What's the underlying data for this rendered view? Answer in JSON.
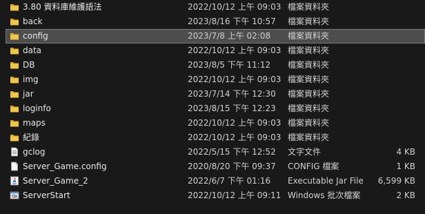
{
  "files": [
    {
      "name": "3.80 資料庫維護語法",
      "date": "2022/10/12 上午 09:03",
      "type": "檔案資料夾",
      "size": "",
      "icon": "folder-icon",
      "selected": false
    },
    {
      "name": "back",
      "date": "2023/8/16 下午 10:57",
      "type": "檔案資料夾",
      "size": "",
      "icon": "folder-icon",
      "selected": false
    },
    {
      "name": "config",
      "date": "2023/7/8 上午 02:08",
      "type": "檔案資料夾",
      "size": "",
      "icon": "folder-icon",
      "selected": true
    },
    {
      "name": "data",
      "date": "2022/10/12 上午 09:03",
      "type": "檔案資料夾",
      "size": "",
      "icon": "folder-icon",
      "selected": false
    },
    {
      "name": "DB",
      "date": "2023/8/5 下午 11:12",
      "type": "檔案資料夾",
      "size": "",
      "icon": "folder-icon",
      "selected": false
    },
    {
      "name": "img",
      "date": "2022/10/12 上午 09:03",
      "type": "檔案資料夾",
      "size": "",
      "icon": "folder-icon",
      "selected": false
    },
    {
      "name": "jar",
      "date": "2023/7/14 下午 12:30",
      "type": "檔案資料夾",
      "size": "",
      "icon": "folder-icon",
      "selected": false
    },
    {
      "name": "loginfo",
      "date": "2023/8/15 下午 12:23",
      "type": "檔案資料夾",
      "size": "",
      "icon": "folder-icon",
      "selected": false
    },
    {
      "name": "maps",
      "date": "2022/10/12 上午 09:03",
      "type": "檔案資料夾",
      "size": "",
      "icon": "folder-icon",
      "selected": false
    },
    {
      "name": "紀錄",
      "date": "2022/10/12 上午 09:03",
      "type": "檔案資料夾",
      "size": "",
      "icon": "folder-icon",
      "selected": false
    },
    {
      "name": "gclog",
      "date": "2022/5/15 下午 12:52",
      "type": "文字文件",
      "size": "4 KB",
      "icon": "text-file-icon",
      "selected": false
    },
    {
      "name": "Server_Game.config",
      "date": "2020/8/20 下午 09:37",
      "type": "CONFIG 檔案",
      "size": "1 KB",
      "icon": "config-file-icon",
      "selected": false
    },
    {
      "name": "Server_Game_2",
      "date": "2022/6/7 下午 01:16",
      "type": "Executable Jar File",
      "size": "6,599 KB",
      "icon": "java-jar-icon",
      "selected": false
    },
    {
      "name": "ServerStart",
      "date": "2022/10/12 上午 09:11",
      "type": "Windows 批次檔案",
      "size": "2 KB",
      "icon": "batch-file-icon",
      "selected": false
    }
  ],
  "colors": {
    "background": "#191919",
    "text": "#e6e6e6",
    "selection": "#4d4d4d",
    "selection_border": "#7a7a7a",
    "folder": "#f0c64a",
    "folder_dark": "#d9a72a"
  }
}
